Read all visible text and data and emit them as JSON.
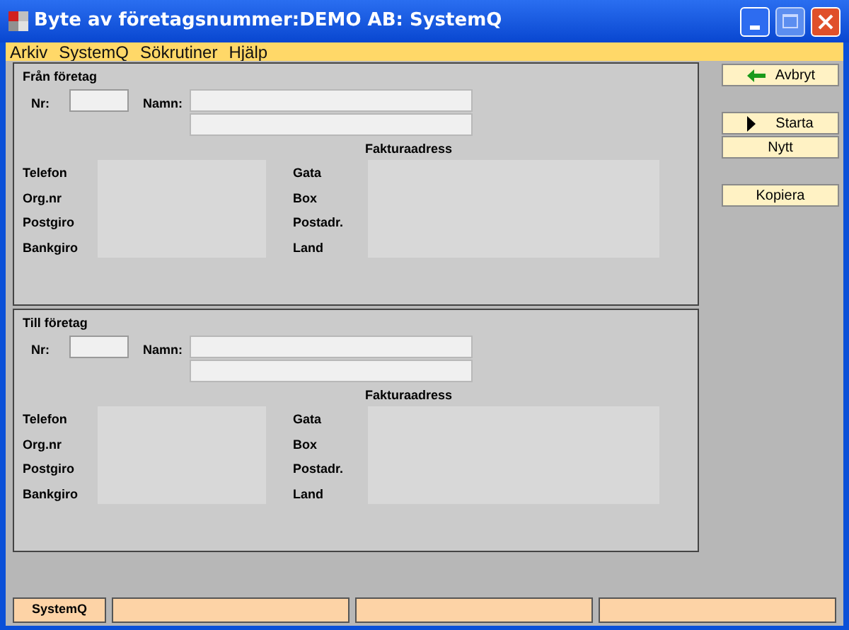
{
  "window": {
    "title": "Byte av företagsnummer:DEMO AB: SystemQ"
  },
  "menu": [
    "Arkiv",
    "SystemQ",
    "Sökrutiner",
    "Hjälp"
  ],
  "sections": [
    {
      "title": "Från företag",
      "nr_label": "Nr:",
      "name_label": "Namn:",
      "address_heading": "Fakturaadress",
      "left_labels": [
        "Telefon",
        "Org.nr",
        "Postgiro",
        "Bankgiro"
      ],
      "right_labels": [
        "Gata",
        "Box",
        "Postadr.",
        "Land"
      ]
    },
    {
      "title": "Till företag",
      "nr_label": "Nr:",
      "name_label": "Namn:",
      "address_heading": "Fakturaadress",
      "left_labels": [
        "Telefon",
        "Org.nr",
        "Postgiro",
        "Bankgiro"
      ],
      "right_labels": [
        "Gata",
        "Box",
        "Postadr.",
        "Land"
      ]
    }
  ],
  "button_groups": [
    [
      {
        "label": "Avbryt",
        "kind": "back"
      }
    ],
    [
      {
        "label": "Starta",
        "kind": "start"
      },
      {
        "label": "Nytt",
        "kind": "plain"
      }
    ],
    [
      {
        "label": "Kopiera",
        "kind": "plain"
      }
    ]
  ],
  "status_bar": {
    "label": "SystemQ"
  }
}
